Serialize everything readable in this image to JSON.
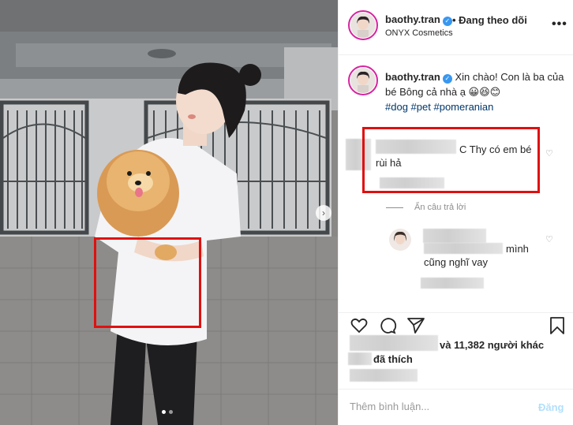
{
  "post": {
    "username": "baothy.tran",
    "follow_status": "• Đang theo dõi",
    "subtitle": "ONYX Cosmetics",
    "more_icon": "ellipsis-icon"
  },
  "caption": {
    "username": "baothy.tran",
    "text": "Xin chào! Con là ba của bé Bông cả nhà ạ 😀😆😊",
    "hashtags": [
      "#dog",
      "#pet",
      "#pomeranian"
    ]
  },
  "comments": [
    {
      "text_line1": "C Thy có em bé",
      "text_line2": "rùi hả",
      "hide_replies": "Ẩn câu trả lời",
      "reply": {
        "text_line1": "mình",
        "text_line2": "cũng nghĩ vay"
      }
    }
  ],
  "likes": {
    "count_text": "và 11,382 người khác",
    "suffix": "đã thích"
  },
  "comment_box": {
    "placeholder": "Thêm bình luận...",
    "post_label": "Đăng"
  },
  "colors": {
    "highlight": "#e01010",
    "verified": "#3897f0",
    "hashtag": "#00376b",
    "post_disabled": "#b2dffc"
  }
}
